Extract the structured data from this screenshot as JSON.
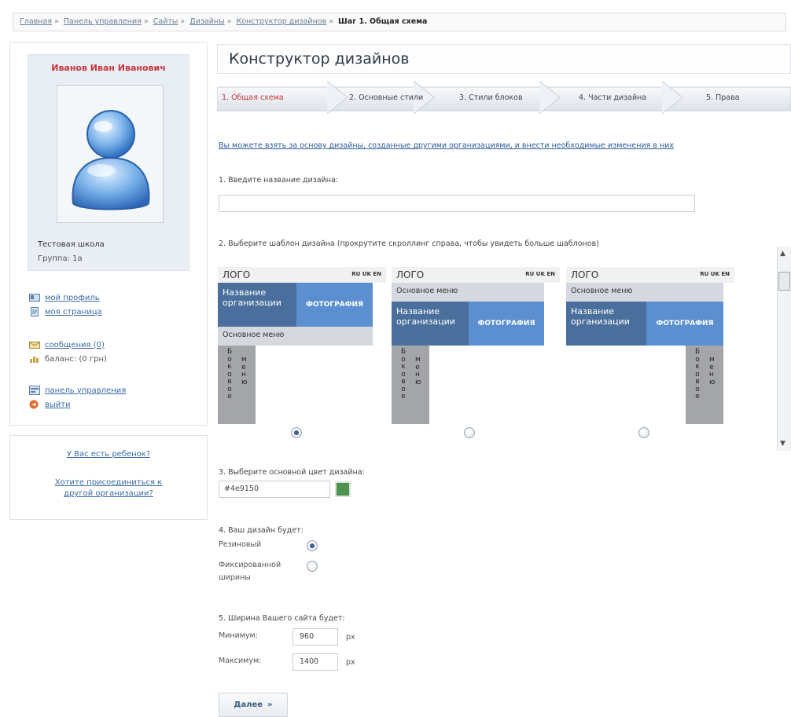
{
  "breadcrumb": {
    "items": [
      "Главная",
      "Панель управления",
      "Сайты",
      "Дизайны",
      "Конструктор дизайнов"
    ],
    "current": "Шаг 1. Общая схема",
    "separator": "»"
  },
  "profile": {
    "name": "Иванов Иван Иванович",
    "school": "Тестовая школа",
    "group": "Группа: 1а"
  },
  "side_links": {
    "profile": "мой профиль",
    "page": "моя страница",
    "messages": "сообщения (0)",
    "balance": "баланс: (0 грн)",
    "panel": "панель управления",
    "logout": "выйти"
  },
  "kids_card": {
    "question": "У Вас есть ребенок?",
    "join": "Хотите присоединиться к другой организации?"
  },
  "page_title": "Конструктор дизайнов",
  "steps": [
    "1. Общая схема",
    "2. Основные стили",
    "3. Стили блоков",
    "4. Части дизайна",
    "5. Права"
  ],
  "info_link": "Вы можете взять за основу дизайны, созданные другими организациями, и внести необходимые изменения в них",
  "q1": "1. Введите название дизайна:",
  "q2": "2. Выберите шаблон дизайна (прокрутите скроллинг справа, чтобы увидеть больше шаблонов)",
  "template_text": {
    "logo": "ЛОГО",
    "langs": "RU UK EN",
    "menu": "Основное меню",
    "org": "Название организации",
    "photo": "ФОТОГРАФИЯ",
    "side": "Боковое меню"
  },
  "q3": "3. Выберите основной цвет дизайна:",
  "color_value": "#4e9150",
  "q4": "4. Ваш дизайн будет:",
  "layout_options": [
    "Резиновый",
    "Фиксированной ширины"
  ],
  "q5": "5. Ширина Вашего сайта будет:",
  "width": {
    "min_label": "Минимум:",
    "min_value": "960",
    "max_label": "Максимум:",
    "max_value": "1400",
    "unit": "px"
  },
  "next_button": "Далее",
  "next_arrow": "»"
}
